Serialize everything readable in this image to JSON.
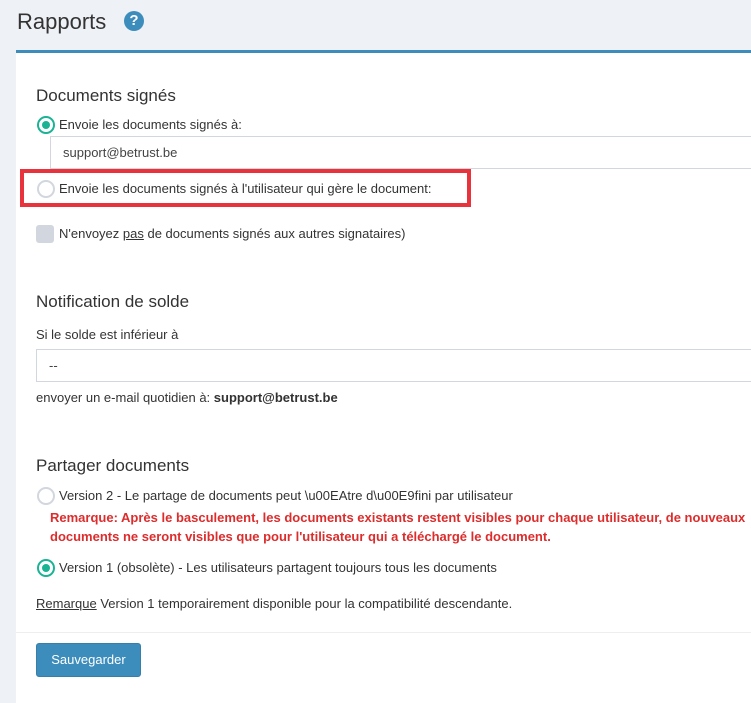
{
  "header": {
    "title": "Rapports",
    "help_icon": "?"
  },
  "signed_docs": {
    "title": "Documents signés",
    "option_send_to": "Envoie les documents signés à:",
    "email_value": "support@betrust.be",
    "option_send_to_manager": "Envoie les documents signés à l'utilisateur qui gère le document:",
    "no_send_prefix": "N'envoyez ",
    "no_send_emph": "pas",
    "no_send_suffix": " de documents signés aux autres signataires)"
  },
  "balance": {
    "title": "Notification de solde",
    "threshold_label": "Si le solde est inférieur à",
    "threshold_value": "--",
    "daily_email_prefix": "envoyer un e-mail quotidien à: ",
    "daily_email_value": "support@betrust.be"
  },
  "share": {
    "title": "Partager documents",
    "version2_label": "Version 2 - Le partage de documents peut \\u00EAtre d\\u00E9fini par utilisateur",
    "version2_warning": "Remarque: Après le basculement, les documents existants restent visibles pour chaque utilisateur, de nouveaux documents ne seront visibles que pour l'utilisateur qui a téléchargé le document.",
    "version1_label": "Version 1 (obsolète) - Les utilisateurs partagent toujours tous les documents",
    "note_link": "Remarque",
    "note_text": " Version 1 temporairement disponible pour la compatibilité descendante."
  },
  "actions": {
    "save_label": "Sauvegarder"
  },
  "colors": {
    "accent": "#3c8dbc",
    "radio_checked": "#1ab394",
    "warning": "#dd2c2c",
    "highlight_box": "#e8333c"
  }
}
